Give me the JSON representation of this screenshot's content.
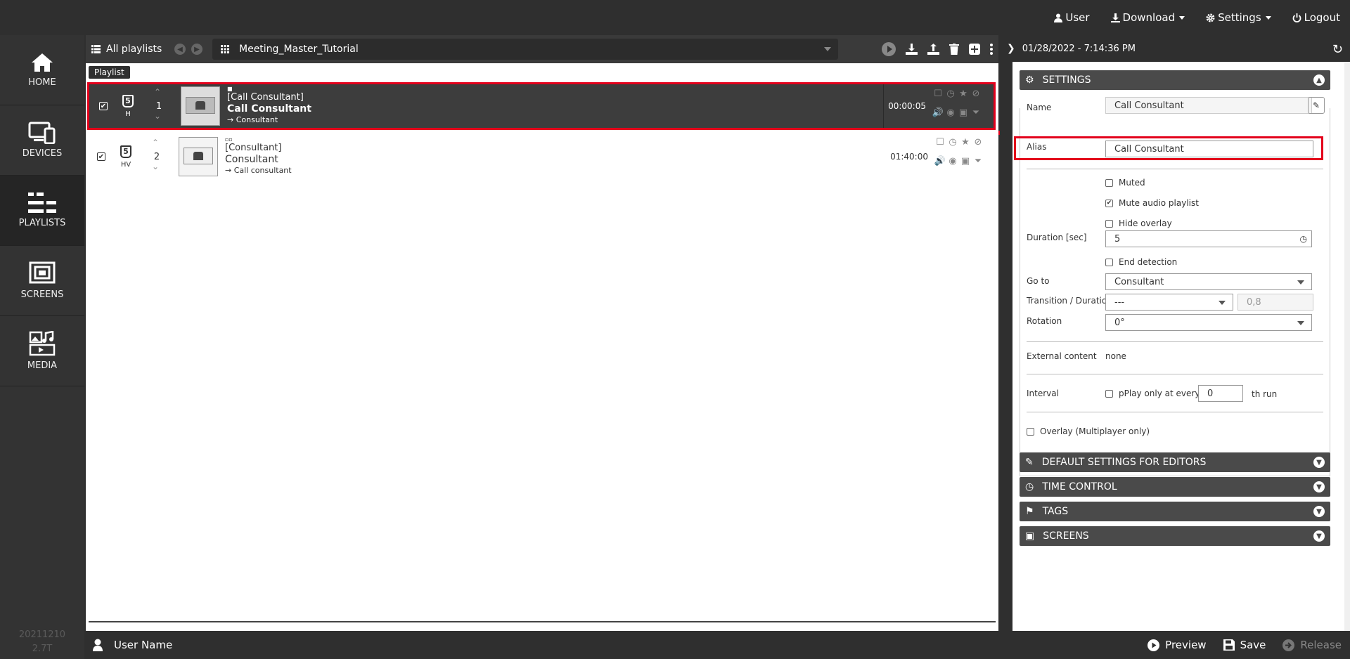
{
  "topmenu": {
    "user": "User",
    "download": "Download",
    "settings": "Settings",
    "logout": "Logout"
  },
  "sidebar": {
    "items": [
      {
        "label": "HOME",
        "icon": "home-icon"
      },
      {
        "label": "DEVICES",
        "icon": "devices-icon"
      },
      {
        "label": "PLAYLISTS",
        "icon": "playlists-icon"
      },
      {
        "label": "SCREENS",
        "icon": "screens-icon"
      },
      {
        "label": "MEDIA",
        "icon": "media-icon"
      }
    ],
    "version_line1": "20211210",
    "version_line2": "2.7T"
  },
  "playlist": {
    "all_playlists": "All playlists",
    "selected": "Meeting_Master_Tutorial",
    "tooltip": "Playlist",
    "rows": [
      {
        "type": "H",
        "index": "1",
        "marker": "■",
        "tag": "[Call Consultant]",
        "name": "Call Consultant",
        "goto": "→ Consultant",
        "duration": "00:00:05",
        "checked": "✔"
      },
      {
        "type": "HV",
        "index": "2",
        "marker": "▫▫",
        "tag": "[Consultant]",
        "name": "Consultant",
        "goto": "→ Call consultant",
        "duration": "01:40:00",
        "checked": "✔"
      }
    ]
  },
  "right": {
    "datetime": "01/28/2022 - 7:14:36 PM",
    "settings_title": "SETTINGS",
    "name_label": "Name",
    "name_value": "Call Consultant",
    "alias_label": "Alias",
    "alias_value": "Call Consultant",
    "muted": "Muted",
    "mute_audio": "Mute audio playlist",
    "hide_overlay": "Hide overlay",
    "duration_label": "Duration [sec]",
    "duration_value": "5",
    "end_detection": "End detection",
    "goto_label": "Go to",
    "goto_value": "Consultant",
    "transition_label": "Transition / Duration",
    "transition_value": "---",
    "transition_duration": "0,8",
    "rotation_label": "Rotation",
    "rotation_value": "0°",
    "external_label": "External content",
    "external_value": "none",
    "interval_label": "Interval",
    "interval_text1": "pPlay only at every",
    "interval_value": "0",
    "interval_text2": "th run",
    "overlay_multi": "Overlay (Multiplayer only)",
    "sections": [
      "DEFAULT SETTINGS FOR EDITORS",
      "TIME CONTROL",
      "TAGS",
      "SCREENS"
    ]
  },
  "footer": {
    "user_name": "User Name",
    "preview": "Preview",
    "save": "Save",
    "release": "Release"
  },
  "colors": {
    "highlight": "#e3001b",
    "dark": "#2f2f2f"
  }
}
